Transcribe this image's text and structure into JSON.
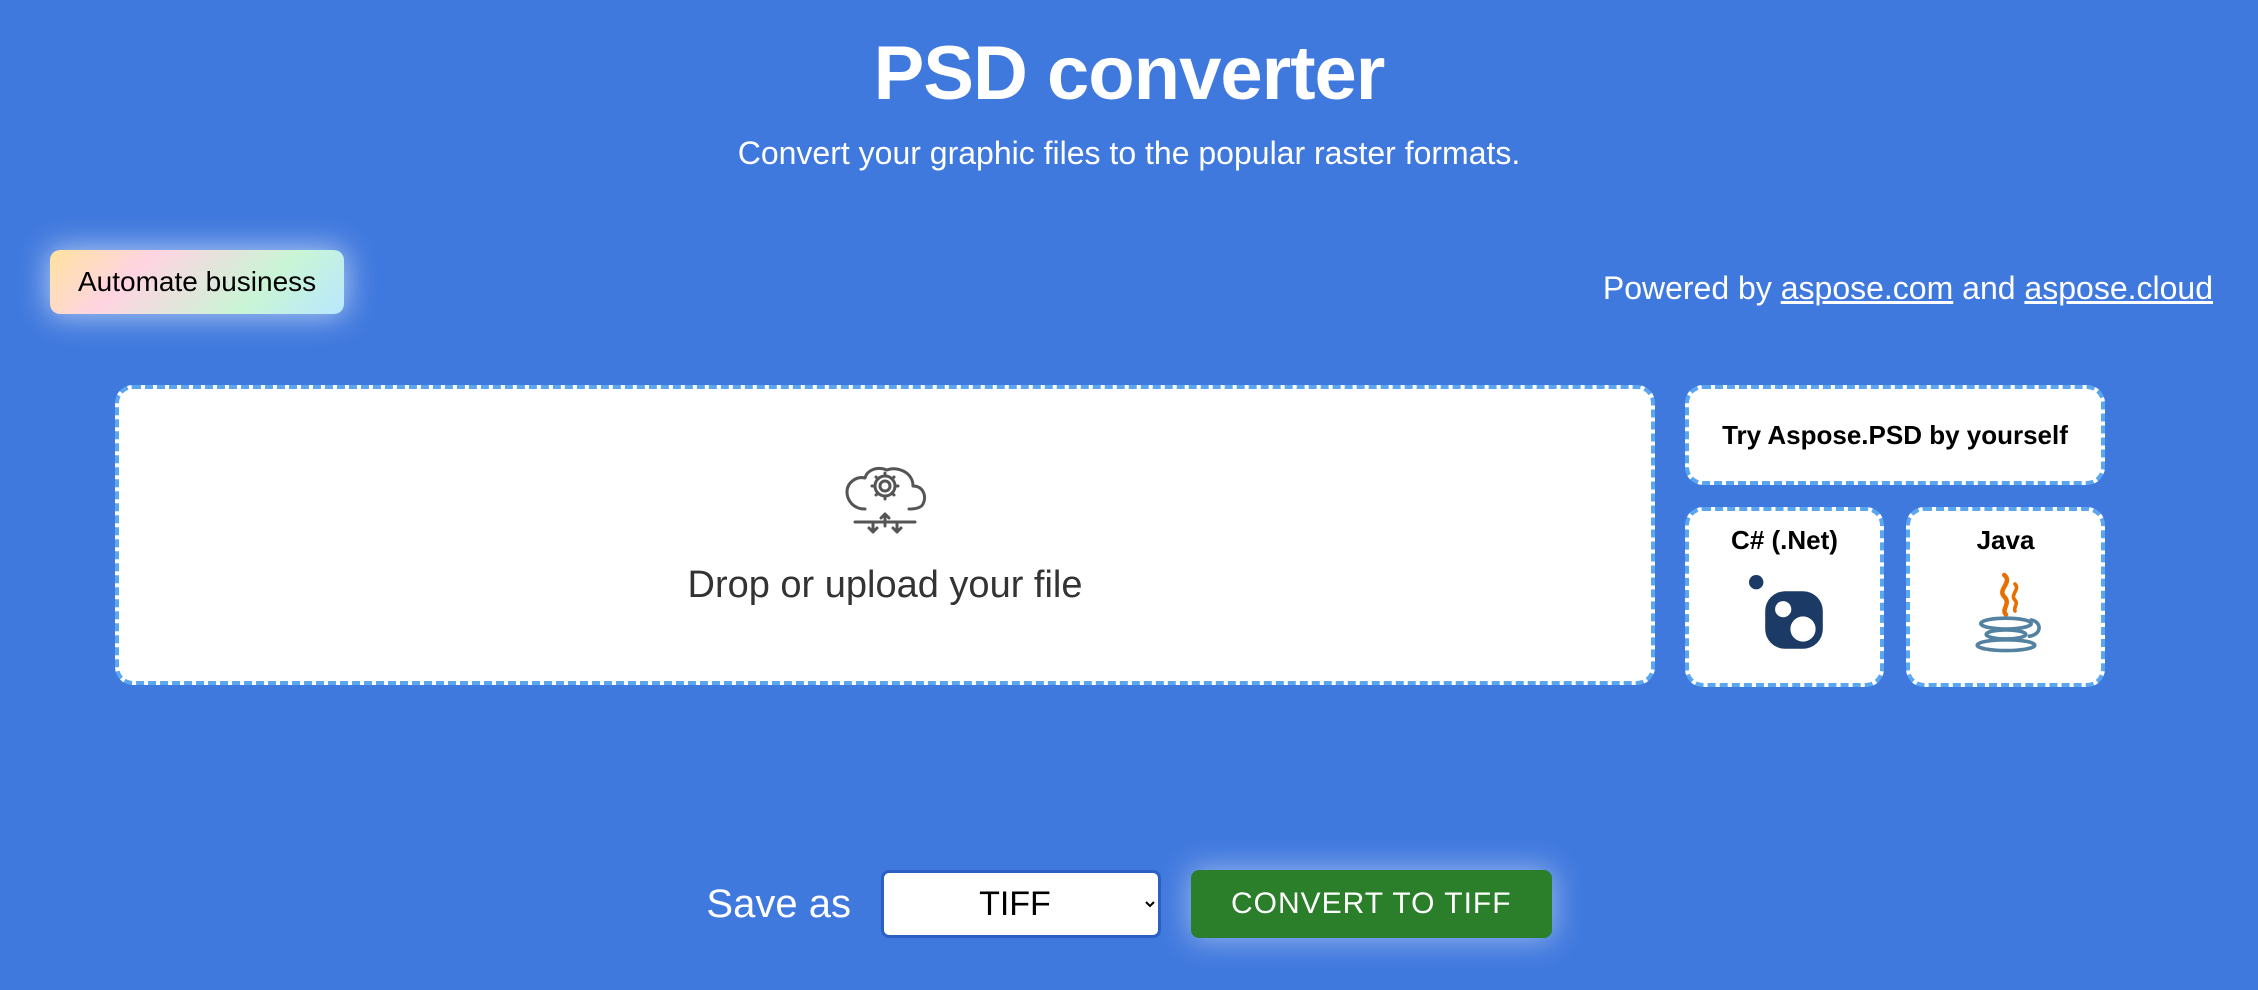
{
  "header": {
    "title": "PSD converter",
    "subtitle": "Convert your graphic files to the popular raster formats."
  },
  "automate": {
    "label": "Automate business"
  },
  "powered": {
    "prefix": "Powered by ",
    "link1": "aspose.com",
    "and": " and ",
    "link2": "aspose.cloud"
  },
  "dropzone": {
    "text": "Drop or upload your file"
  },
  "side": {
    "try_label": "Try Aspose.PSD by yourself",
    "langs": [
      {
        "label": "C# (.Net)"
      },
      {
        "label": "Java"
      }
    ]
  },
  "bottom": {
    "saveas_label": "Save as",
    "selected_format": "TIFF",
    "convert_label": "CONVERT TO TIFF"
  }
}
